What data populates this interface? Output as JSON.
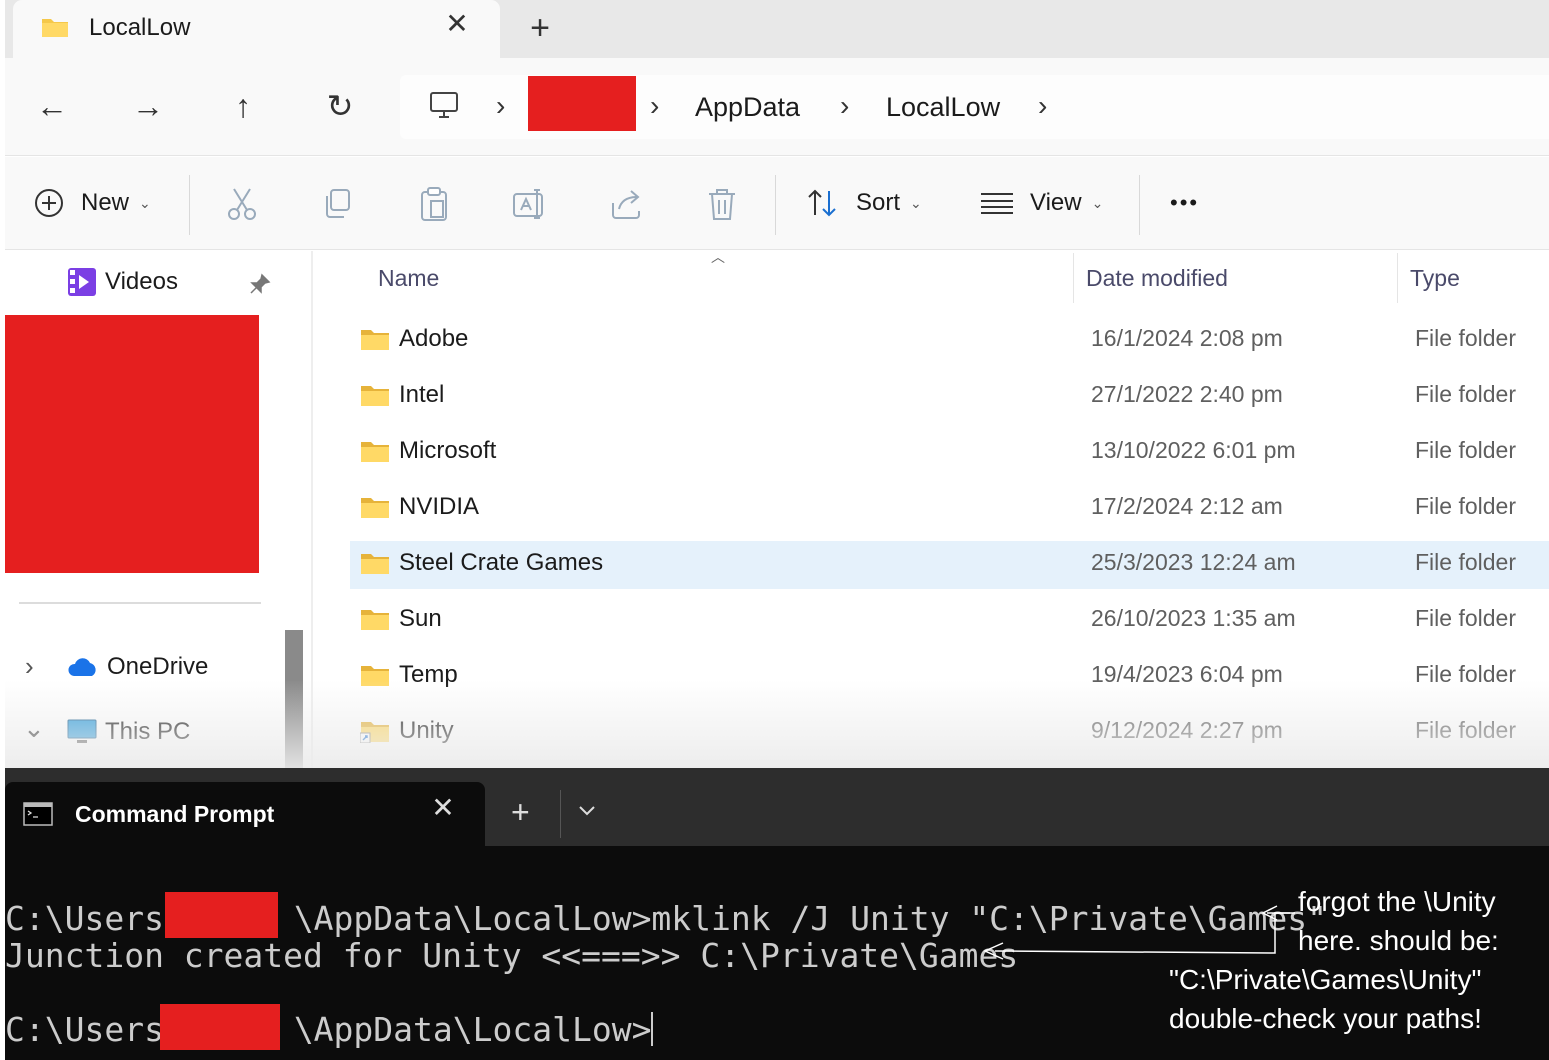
{
  "explorer": {
    "tab": {
      "title": "LocalLow",
      "close": "✕",
      "new_tab": "+"
    },
    "nav": {
      "back": "←",
      "forward": "→",
      "up": "↑",
      "refresh": "↻"
    },
    "breadcrumb": {
      "sep": "›",
      "items": [
        "AppData",
        "LocalLow"
      ]
    },
    "commands": {
      "new_label": "New",
      "sort_label": "Sort",
      "view_label": "View",
      "more": "•••",
      "chevron": "⌄"
    },
    "sidebar": {
      "videos": "Videos",
      "onedrive": "OneDrive",
      "thispc": "This PC",
      "expand": "›",
      "collapse": "⌄"
    },
    "columns": {
      "name": "Name",
      "date": "Date modified",
      "type": "Type"
    },
    "files": [
      {
        "name": "Adobe",
        "date": "16/1/2024 2:08 pm",
        "type": "File folder"
      },
      {
        "name": "Intel",
        "date": "27/1/2022 2:40 pm",
        "type": "File folder"
      },
      {
        "name": "Microsoft",
        "date": "13/10/2022 6:01 pm",
        "type": "File folder"
      },
      {
        "name": "NVIDIA",
        "date": "17/2/2024 2:12 am",
        "type": "File folder"
      },
      {
        "name": "Steel Crate Games",
        "date": "25/3/2023 12:24 am",
        "type": "File folder"
      },
      {
        "name": "Sun",
        "date": "26/10/2023 1:35 am",
        "type": "File folder"
      },
      {
        "name": "Temp",
        "date": "19/4/2023 6:04 pm",
        "type": "File folder"
      },
      {
        "name": "Unity",
        "date": "9/12/2024 2:27 pm",
        "type": "File folder"
      }
    ],
    "selected_file": "Steel Crate Games"
  },
  "terminal": {
    "tab_title": "Command Prompt",
    "close": "✕",
    "new_tab": "+",
    "line1_prefix": "C:\\Users\\",
    "line1_rest": "\\AppData\\LocalLow>mklink /J Unity \"C:\\Private\\Games\"",
    "line2": "Junction created for Unity <<===>> C:\\Private\\Games",
    "line3_prefix": "C:\\Users\\",
    "line3_rest": "\\AppData\\LocalLow>"
  },
  "annotation": {
    "line1": "forgot the \\Unity",
    "line2": "here. should be:",
    "line3": "\"C:\\Private\\Games\\Unity\"",
    "line4": "double-check your paths!"
  },
  "colors": {
    "redaction": "#e51f1f",
    "selection": "#e5f1fb",
    "folder": "#f5c84a"
  }
}
